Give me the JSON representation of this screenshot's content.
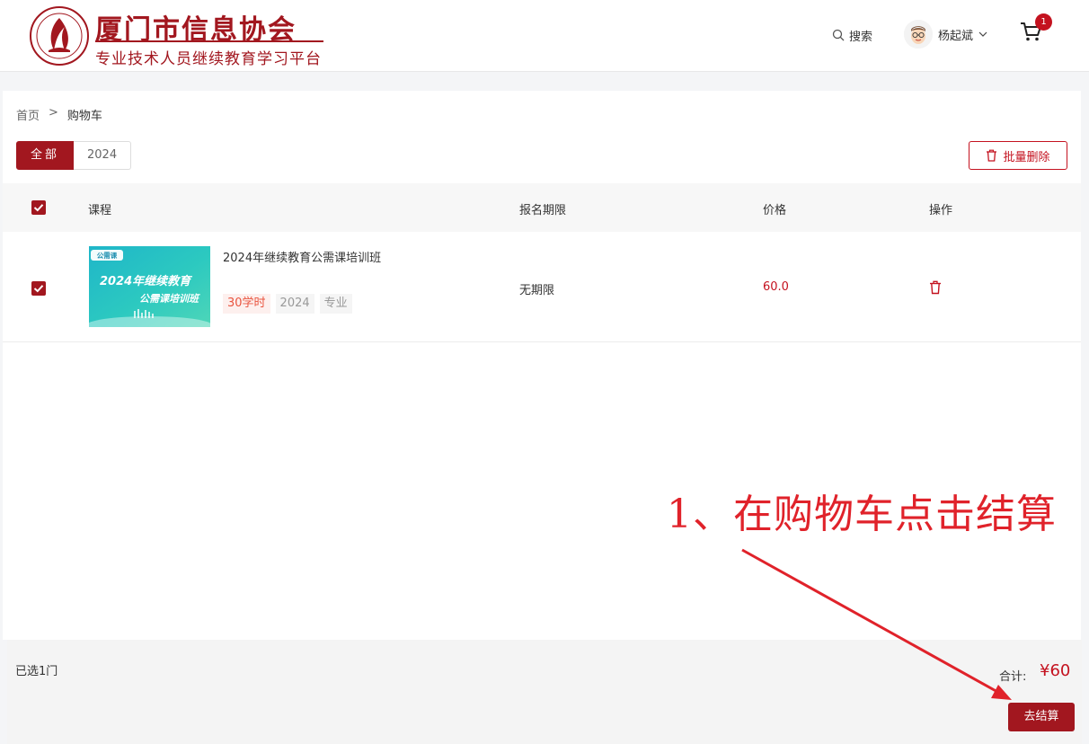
{
  "header": {
    "brand_title": "厦门市信息协会",
    "brand_subtitle": "专业技术人员继续教育学习平台",
    "search_label": "搜索",
    "user_name": "杨起斌",
    "cart_count": "1"
  },
  "breadcrumb": {
    "home": "首页",
    "separator": ">",
    "current": "购物车"
  },
  "tabs": [
    {
      "label": "全部",
      "active": true
    },
    {
      "label": "2024",
      "active": false
    }
  ],
  "actions": {
    "bulk_delete": "批量删除"
  },
  "table": {
    "headers": [
      "课程",
      "报名期限",
      "价格",
      "操作"
    ],
    "rows": [
      {
        "checked": true,
        "thumb_tag": "公需课",
        "thumb_line1": "2024年继续教育",
        "thumb_line2": "公需课培训班",
        "title": "2024年继续教育公需课培训班",
        "tags": [
          "30学时",
          "2024",
          "专业"
        ],
        "period": "无期限",
        "price": "60.0"
      }
    ]
  },
  "footer": {
    "selected": "已选1门",
    "total_label": "合计:",
    "total_value": "¥60",
    "checkout": "去结算"
  },
  "annotation": {
    "text": "1、在购物车点击结算"
  },
  "colors": {
    "brand": "#a2171f",
    "price": "#c4121f",
    "annotation": "#e0222a",
    "hours_tag": "#e9543f"
  }
}
